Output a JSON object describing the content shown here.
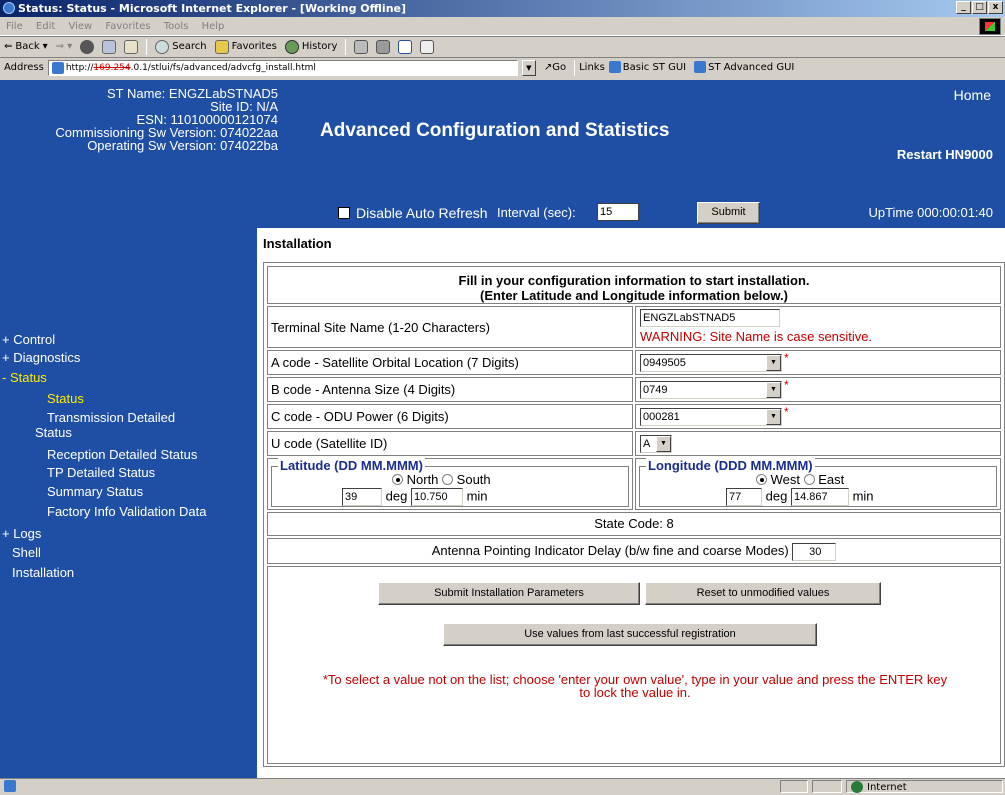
{
  "window": {
    "title": "Status: Status - Microsoft Internet Explorer - [Working Offline]",
    "buttons": [
      "_",
      "□",
      "x"
    ]
  },
  "menu": [
    "File",
    "Edit",
    "View",
    "Favorites",
    "Tools",
    "Help"
  ],
  "toolbar": {
    "back": "Back",
    "search": "Search",
    "favorites": "Favorites",
    "history": "History"
  },
  "addressbar": {
    "label": "Address",
    "url_prefix": "http://",
    "url_struck": "169.254",
    "url_rest": ".0.1/stlui/fs/advanced/advcfg_install.html",
    "go": "Go",
    "links_label": "Links",
    "link_basic": "Basic ST GUI",
    "link_advanced": "ST Advanced GUI"
  },
  "header": {
    "st_name": "ST Name: ENGZLabSTNAD5",
    "site_id": "Site ID: N/A",
    "esn": "ESN: 110100000121074",
    "commissioning": "Commissioning Sw Version: 074022aa",
    "operating": "Operating Sw Version: 074022ba",
    "title": "Advanced Configuration and Statistics",
    "home": "Home",
    "restart": "Restart HN9000",
    "disable_refresh": "Disable Auto Refresh",
    "interval_label": "Interval (sec):",
    "interval_value": "15",
    "submit": "Submit",
    "uptime": "UpTime 000:00:01:40"
  },
  "sidebar": {
    "control": "+ Control",
    "diagnostics": "+ Diagnostics",
    "status": "- Status",
    "status_items": {
      "status": "Status",
      "transmission_1": "Transmission Detailed",
      "transmission_2": "Status",
      "reception": "Reception Detailed Status",
      "tp": "TP Detailed Status",
      "summary": "Summary Status",
      "factory": "Factory Info Validation Data"
    },
    "logs": "+ Logs",
    "shell": "Shell",
    "installation": "Installation"
  },
  "content": {
    "section_title": "Installation",
    "intro_line1": "Fill in your configuration information to start installation.",
    "intro_line2": "(Enter Latitude and Longitude information below.)",
    "site_name_label": "Terminal Site Name (1-20 Characters)",
    "site_name_value": "ENGZLabSTNAD5",
    "site_name_warning": "WARNING: Site Name is case sensitive.",
    "a_code_label": "A code - Satellite Orbital Location (7 Digits)",
    "a_code_value": "0949505",
    "b_code_label": "B code - Antenna Size (4 Digits)",
    "b_code_value": "0749",
    "c_code_label": "C code - ODU Power (6 Digits)",
    "c_code_value": "000281",
    "u_code_label": "U code (Satellite ID)",
    "u_code_value": "A",
    "required_mark": "*",
    "latitude": {
      "legend": "Latitude (DD MM.MMM)",
      "north": "North",
      "south": "South",
      "deg_value": "39",
      "deg_label": "deg",
      "min_value": "10.750",
      "min_label": "min"
    },
    "longitude": {
      "legend": "Longitude (DDD MM.MMM)",
      "west": "West",
      "east": "East",
      "deg_value": "77",
      "deg_label": "deg",
      "min_value": "14.867",
      "min_label": "min"
    },
    "state_code": "State Code: 8",
    "api_delay_label": "Antenna Pointing Indicator Delay (b/w fine and coarse Modes)",
    "api_delay_value": "30",
    "submit_params": "Submit Installation Parameters",
    "reset": "Reset to unmodified values",
    "use_last": "Use values from last successful registration",
    "footnote_star": "*",
    "footnote_line1": "To select a value not on the list; choose 'enter your own value', type in your value and press the ENTER key",
    "footnote_line2": "to lock the value in."
  },
  "statusbar": {
    "zone": "Internet"
  },
  "colors": {
    "header_blue": "#1f4fa4",
    "active_yellow": "#ffeb00",
    "warning_red": "#c00000",
    "legend_blue": "#1a2d8f"
  }
}
